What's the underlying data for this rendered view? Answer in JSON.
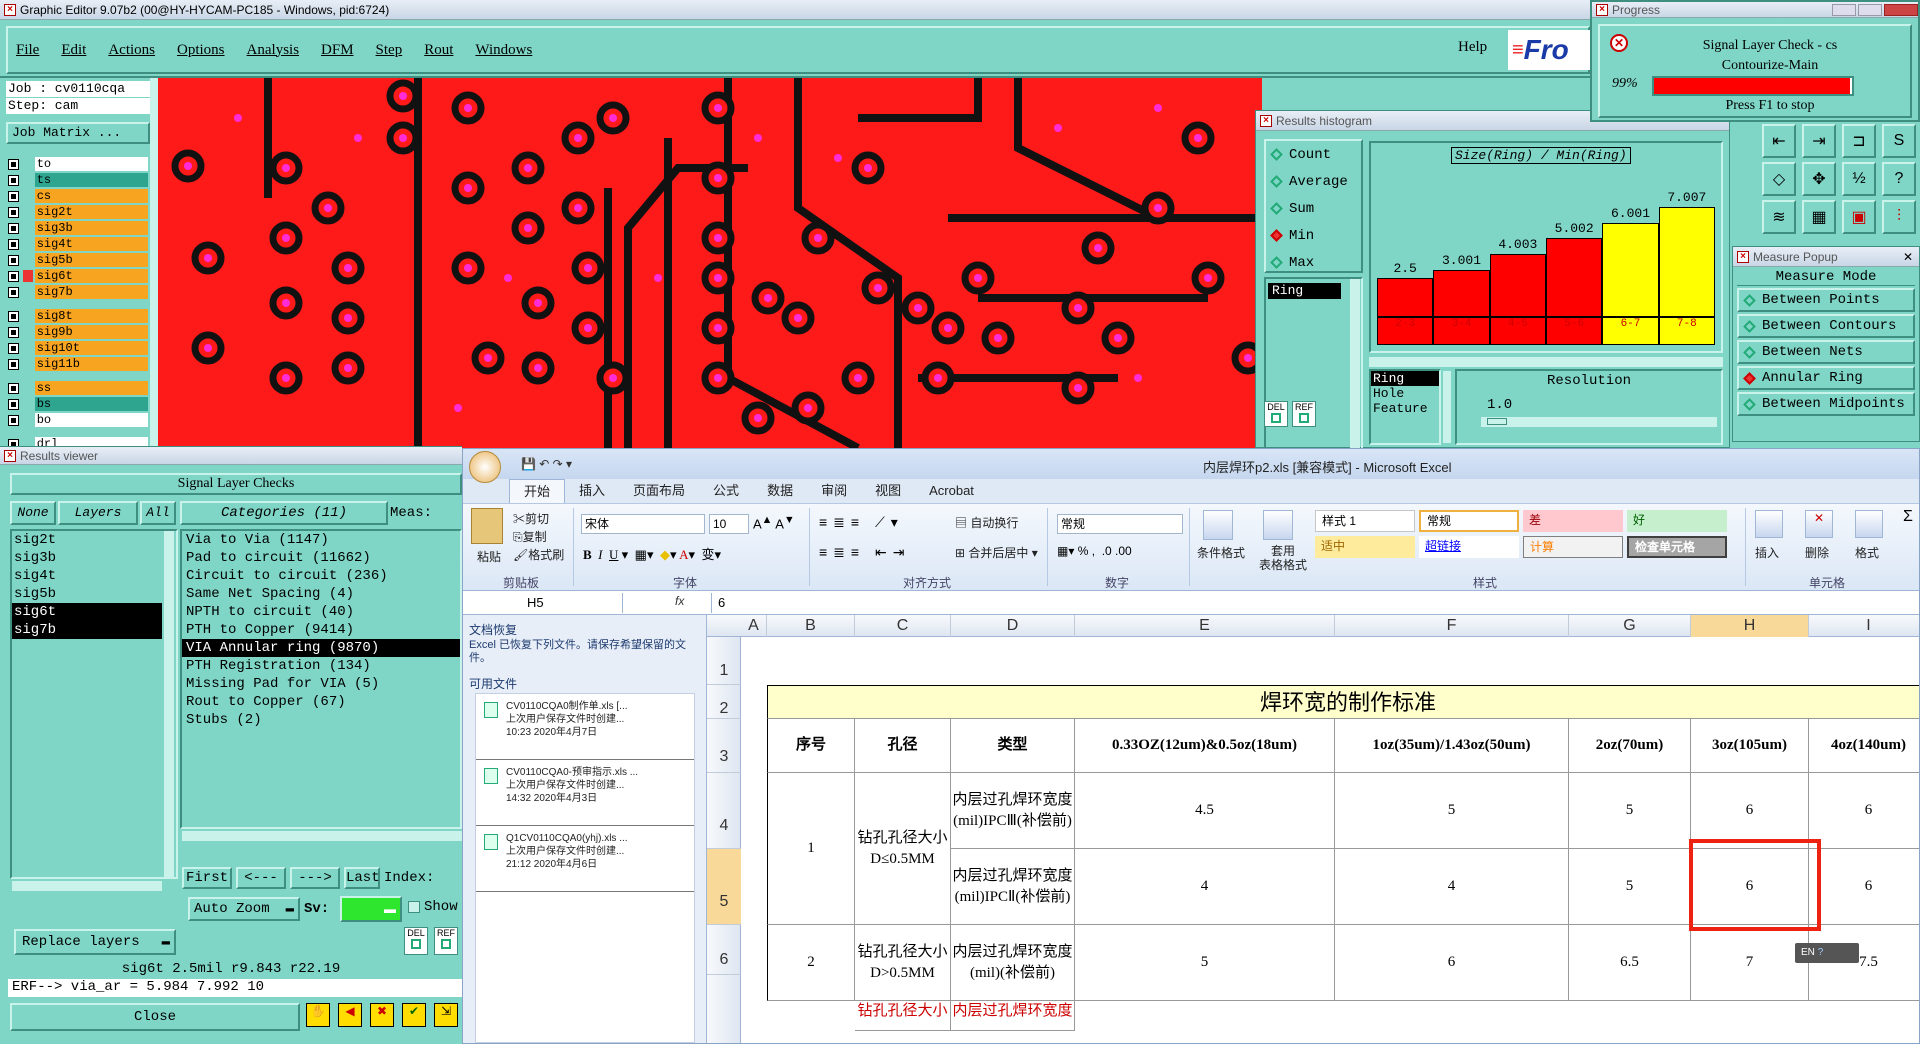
{
  "editor": {
    "title": "Graphic Editor 9.07b2 (00@HY-HYCAM-PC185 - Windows, pid:6724)",
    "menu": [
      "File",
      "Edit",
      "Actions",
      "Options",
      "Analysis",
      "DFM",
      "Step",
      "Rout",
      "Windows"
    ],
    "help": "Help",
    "brand": "Fro",
    "job_line": "Job : cv0110cqa",
    "step_line": "Step: cam",
    "job_matrix": "Job Matrix ..."
  },
  "layers": [
    {
      "name": "to",
      "color": "#ffffff"
    },
    {
      "name": "ts",
      "color": "#2ea58f"
    },
    {
      "name": "cs",
      "color": "#f7a520"
    },
    {
      "name": "sig2t",
      "color": "#f7a520"
    },
    {
      "name": "sig3b",
      "color": "#f7a520"
    },
    {
      "name": "sig4t",
      "color": "#f7a520"
    },
    {
      "name": "sig5b",
      "color": "#f7a520"
    },
    {
      "name": "sig6t",
      "color": "#f7a520"
    },
    {
      "name": "sig7b",
      "color": "#f7a520"
    },
    {
      "name": "sig8t",
      "color": "#f7a520"
    },
    {
      "name": "sig9b",
      "color": "#f7a520"
    },
    {
      "name": "sig10t",
      "color": "#f7a520"
    },
    {
      "name": "sig11b",
      "color": "#f7a520"
    },
    {
      "name": "ss",
      "color": "#f7a520"
    },
    {
      "name": "bs",
      "color": "#2ea58f"
    },
    {
      "name": "bo",
      "color": "#ffffff"
    },
    {
      "name": "drl",
      "color": "#ffffff"
    }
  ],
  "results_viewer": {
    "title": "Results viewer",
    "header": "Signal Layer Checks",
    "tab_none": "None",
    "tab_layers": "Layers",
    "tab_all": "All",
    "categories_label": "Categories (11)",
    "meas_label": "Meas:",
    "layer_list": [
      "sig2t",
      "sig3b",
      "sig4t",
      "sig5b",
      "sig6t",
      "sig7b"
    ],
    "categories": [
      "Via to Via (1147)",
      "Pad to circuit (11662)",
      "Circuit to circuit (236)",
      "Same Net Spacing (4)",
      "NPTH to circuit (40)",
      "PTH to Copper (9414)",
      "VIA Annular ring (9870)",
      "PTH Registration (134)",
      "Missing Pad for VIA (5)",
      "Rout to Copper (67)",
      "Stubs (2)"
    ],
    "btn_first": "First",
    "btn_prev": "<---",
    "btn_next": "--->",
    "btn_last": "Last",
    "index_label": "Index:",
    "auto_zoom": "Auto Zoom",
    "sv_label": "Sv:",
    "show_label": "Show",
    "replace_layers": "Replace layers",
    "status_line": "sig6t 2.5mil   r9.843   r22.19",
    "erf_line": "ERF--> via_ar = 5.984 7.992 10",
    "close": "Close",
    "del": "DEL",
    "ref": "REF"
  },
  "histogram": {
    "title": "Results histogram",
    "options": [
      "Count",
      "Average",
      "Sum",
      "Min",
      "Max"
    ],
    "selected": "Min",
    "field": "Ring",
    "chart_title": "Size(Ring) / Min(Ring)",
    "list": [
      "Ring",
      "Hole",
      "Feature"
    ],
    "resolution_label": "Resolution",
    "resolution": "1.0",
    "del": "DEL",
    "ref": "REF"
  },
  "chart_data": {
    "type": "bar",
    "categories": [
      "2-3",
      "3-4",
      "4-5",
      "5-6",
      "6-7",
      "7-8"
    ],
    "values": [
      2.5,
      3.001,
      4.003,
      5.002,
      6.001,
      7.007
    ],
    "value_labels": [
      "2.5",
      "3.001",
      "4.003",
      "5.002",
      "6.001",
      "7.007"
    ],
    "colors": [
      "#ff0000",
      "#ff0000",
      "#ff0000",
      "#ff0000",
      "#ffff00",
      "#ffff00"
    ],
    "title": "Size(Ring) / Min(Ring)",
    "ylim": [
      0,
      7.5
    ]
  },
  "progress": {
    "title": "Progress",
    "line1": "Signal Layer Check - cs",
    "line2": "Contourize-Main",
    "percent": "99%",
    "level": 0.99,
    "hint": "Press F1 to stop"
  },
  "measure": {
    "title": "Measure Popup",
    "header": "Measure Mode",
    "options": [
      "Between Points",
      "Between Contours",
      "Between Nets",
      "Annular Ring",
      "Between Midpoints"
    ],
    "selected": "Annular Ring"
  },
  "excel": {
    "title": "内层焊环p2.xls [兼容模式] - Microsoft Excel",
    "tabs": [
      "开始",
      "插入",
      "页面布局",
      "公式",
      "数据",
      "审阅",
      "视图",
      "Acrobat"
    ],
    "clipboard": {
      "paste": "粘贴",
      "cut": "剪切",
      "copy": "复制",
      "format": "格式刷",
      "group": "剪贴板"
    },
    "font": {
      "name": "宋体",
      "size": "10",
      "group": "字体"
    },
    "align": {
      "wrap": "自动换行",
      "merge": "合并后居中",
      "group": "对齐方式"
    },
    "number": {
      "format": "常规",
      "group": "数字"
    },
    "styles": {
      "cond": "条件格式",
      "table": "套用\n表格格式",
      "s1": "样式 1",
      "normal": "常规",
      "bad": "差",
      "good": "好",
      "neutral": "适中",
      "link": "超链接",
      "calc": "计算",
      "check": "检查单元格",
      "group": "样式"
    },
    "cells": {
      "insert": "插入",
      "delete": "删除",
      "format": "格式",
      "group": "单元格"
    },
    "namebox": "H5",
    "fx": "fx",
    "formula": "6",
    "recovery": {
      "title": "文档恢复",
      "desc": "Excel 已恢复下列文件。请保存希望保留的文件。",
      "avail": "可用文件",
      "files": [
        {
          "name": "CV0110CQA0制作单.xls  [...",
          "note": "上次用户保存文件时创建...",
          "time": "10:23  2020年4月7日"
        },
        {
          "name": "CV0110CQA0-预审指示.xls ...",
          "note": "上次用户保存文件时创建...",
          "time": "14:32  2020年4月3日"
        },
        {
          "name": "Q1CV0110CQA0(yhj).xls ...",
          "note": "上次用户保存文件时创建...",
          "time": "21:12  2020年4月6日"
        }
      ]
    },
    "col_headers": [
      "A",
      "B",
      "C",
      "D",
      "E",
      "F",
      "G",
      "H",
      "I"
    ],
    "row_headers": [
      "1",
      "2",
      "3",
      "4",
      "5",
      "6"
    ],
    "sheet": {
      "title": "焊环宽的制作标准",
      "headers": [
        "序号",
        "孔径",
        "类型",
        "0.33OZ(12um)&0.5oz(18um)",
        "1oz(35um)/1.43oz(50um)",
        "2oz(70um)",
        "3oz(105um)",
        "4oz(140um)"
      ],
      "r1_no": "1",
      "r1_hole": "钻孔孔径大小D≤0.5MM",
      "r1a_type": "内层过孔焊环宽度(mil)IPCⅢ(补偿前)",
      "r1a": [
        "4.5",
        "5",
        "5",
        "6",
        "6"
      ],
      "r1b_type": "内层过孔焊环宽度(mil)IPCⅡ(补偿前)",
      "r1b": [
        "4",
        "4",
        "5",
        "6",
        "6"
      ],
      "r2_no": "2",
      "r2_hole": "钻孔孔径大小D>0.5MM",
      "r2_type": "内层过孔焊环宽度(mil)(补偿前)",
      "r2": [
        "5",
        "6",
        "6.5",
        "7",
        "7.5"
      ],
      "r3_hole": "钻孔孔径大小",
      "r3_type": "内层过孔焊环宽度"
    },
    "ime": "EN"
  }
}
